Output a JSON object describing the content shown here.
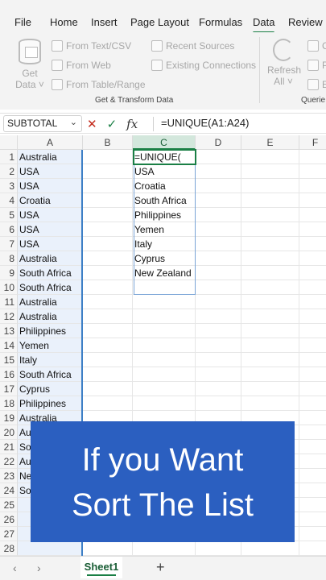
{
  "ribbon_tabs": [
    "File",
    "Home",
    "Insert",
    "Page Layout",
    "Formulas",
    "Data",
    "Review"
  ],
  "active_tab": "Data",
  "ribbon": {
    "get_data": [
      "Get",
      "Data ˅"
    ],
    "from_text_csv": "From Text/CSV",
    "from_web": "From Web",
    "from_table_range": "From Table/Range",
    "recent_sources": "Recent Sources",
    "existing_connections": "Existing Connections",
    "refresh_all": [
      "Refresh",
      "All ˅"
    ],
    "clipped": [
      "C",
      "P",
      "E"
    ],
    "group_get_transform": "Get & Transform Data",
    "group_queries": "Querie"
  },
  "formula_bar": {
    "name_box": "SUBTOTAL",
    "cancel_icon": "✕",
    "enter_icon": "✓",
    "fx_icon": "fx",
    "formula": "=UNIQUE(A1:A24)"
  },
  "columns": [
    "A",
    "B",
    "C",
    "D",
    "E",
    "F"
  ],
  "rows": [
    "1",
    "2",
    "3",
    "4",
    "5",
    "6",
    "7",
    "8",
    "9",
    "10",
    "11",
    "12",
    "13",
    "14",
    "15",
    "16",
    "17",
    "18",
    "19",
    "20",
    "21",
    "22",
    "23",
    "24",
    "25",
    "26",
    "27",
    "28"
  ],
  "column_a": [
    "Australia",
    "USA",
    "USA",
    "Croatia",
    "USA",
    "USA",
    "USA",
    "Australia",
    "South Africa",
    "South Africa",
    "Australia",
    "Australia",
    "Philippines",
    "Yemen",
    "Italy",
    "South Africa",
    "Cyprus",
    "Philippines",
    "Australia",
    "Au",
    "So",
    "Au",
    "Ne",
    "So"
  ],
  "column_c": [
    "=UNIQUE(",
    "USA",
    "Croatia",
    "South Africa",
    "Philippines",
    "Yemen",
    "Italy",
    "Cyprus",
    "New Zealand"
  ],
  "banner": {
    "line1": "If you Want",
    "line2": "Sort The List"
  },
  "sheet_tab": "Sheet1",
  "add_sheet": "+",
  "nav_prev": "‹",
  "nav_next": "›",
  "colors": {
    "accent": "#1a7f45",
    "banner": "#2b5fc0",
    "colA_fill": "#eaf1fb"
  }
}
